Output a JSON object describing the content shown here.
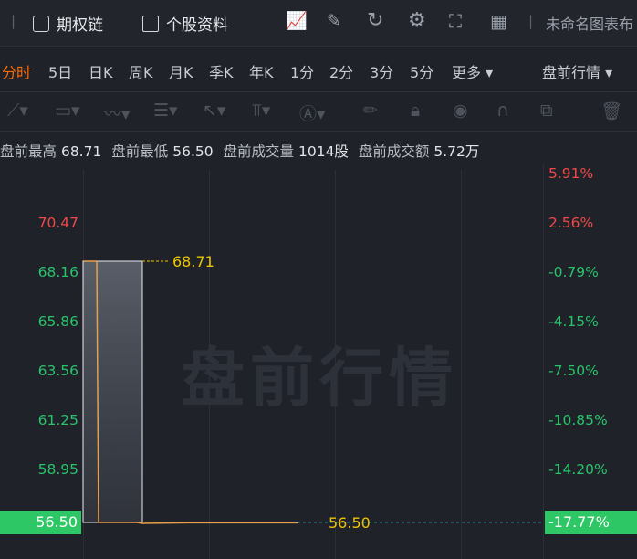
{
  "toolbar": {
    "option_chain": "期权链",
    "stock_info": "个股资料",
    "chart_name": "未命名图表布"
  },
  "periods": [
    "分时",
    "5日",
    "日K",
    "周K",
    "月K",
    "季K",
    "年K",
    "1分",
    "2分",
    "3分",
    "5分",
    "更多 ▾"
  ],
  "active_period": "分时",
  "session_selector": "盘前行情 ▾",
  "info": {
    "high_label": "盘前最高",
    "high_value": "68.71",
    "low_label": "盘前最低",
    "low_value": "56.50",
    "volume_label": "盘前成交量",
    "volume_value": "1014股",
    "amount_label": "盘前成交额",
    "amount_value": "5.72万"
  },
  "y_axis_left": [
    "70.47",
    "68.16",
    "65.86",
    "63.56",
    "61.25",
    "58.95"
  ],
  "y_axis_right": [
    "5.91%",
    "2.56%",
    "-0.79%",
    "-4.15%",
    "-7.50%",
    "-10.85%",
    "-14.20%"
  ],
  "current": {
    "price": "56.50",
    "percent": "-17.77%"
  },
  "annotations": {
    "high": "68.71",
    "low": "56.50"
  },
  "watermark": "盘前行情",
  "colors": {
    "up": "#f04848",
    "down": "#29c36a",
    "active": "#ff6a00",
    "line": "#e8a04a",
    "marker": "#f0c400"
  },
  "chart_data": {
    "type": "line",
    "title": "",
    "series": [
      {
        "values": [
          68.71,
          68.71,
          68.71,
          56.5,
          56.5,
          56.5,
          56.4,
          56.4,
          56.5
        ]
      }
    ],
    "ylim": [
      55.8,
      72.0
    ]
  }
}
